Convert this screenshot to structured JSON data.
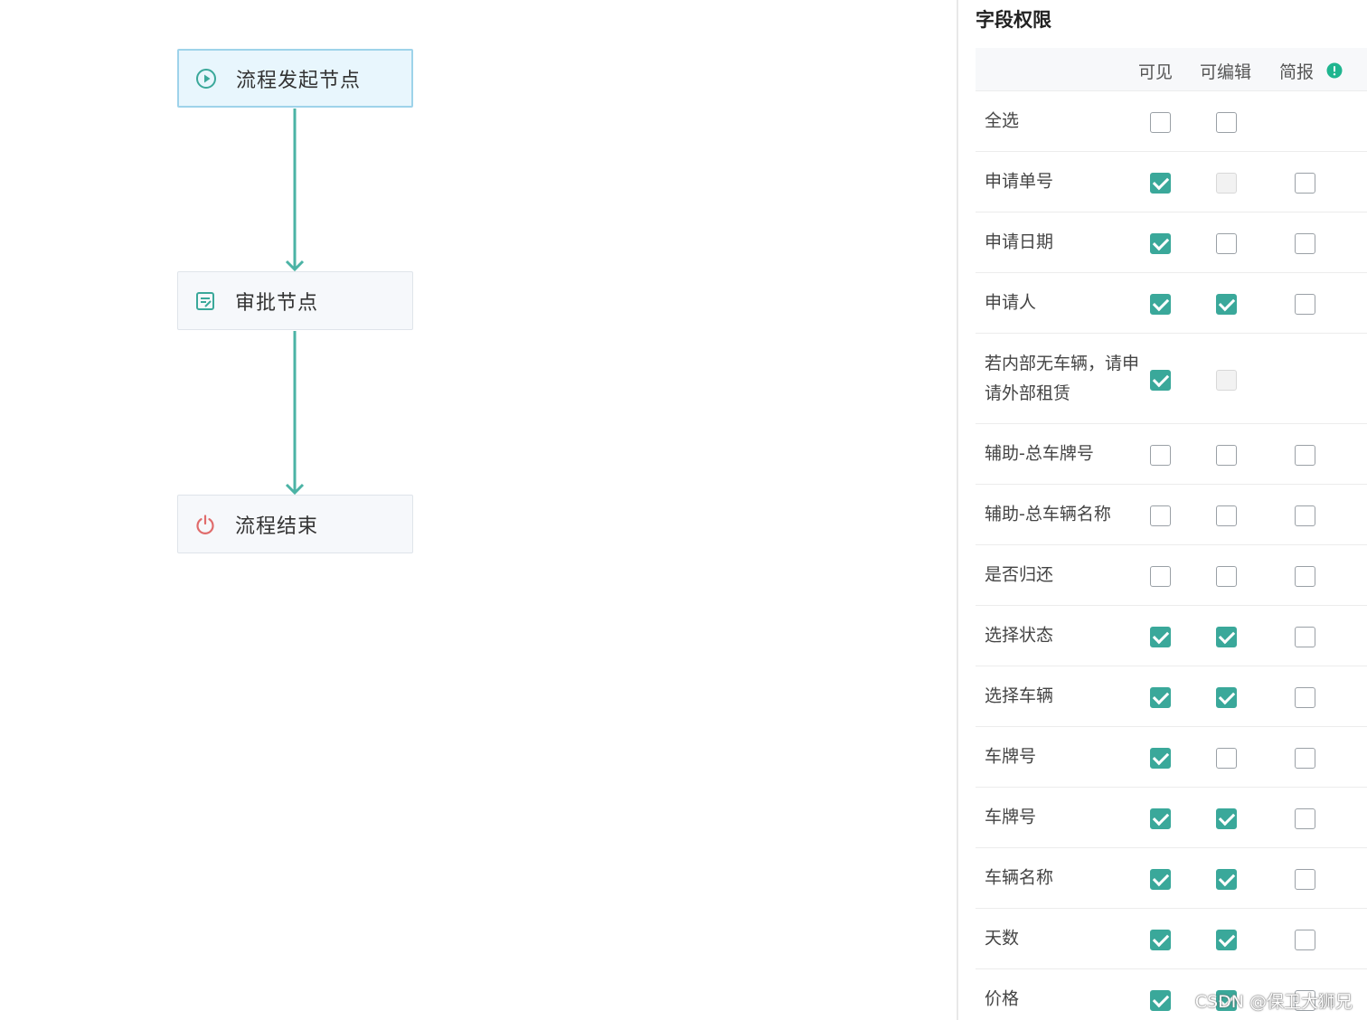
{
  "flow": {
    "nodes": [
      {
        "label": "流程发起节点",
        "icon": "play-circle-icon"
      },
      {
        "label": "审批节点",
        "icon": "approval-form-icon"
      },
      {
        "label": "流程结束",
        "icon": "power-icon"
      }
    ]
  },
  "panel": {
    "title": "字段权限",
    "headers": {
      "visible": "可见",
      "editable": "可编辑",
      "brief": "简报"
    },
    "rows": [
      {
        "name": "全选",
        "visible": "unchecked",
        "editable": "unchecked",
        "brief": "none"
      },
      {
        "name": "申请单号",
        "visible": "checked",
        "editable": "disabled",
        "brief": "unchecked"
      },
      {
        "name": "申请日期",
        "visible": "checked",
        "editable": "unchecked",
        "brief": "unchecked"
      },
      {
        "name": "申请人",
        "visible": "checked",
        "editable": "checked",
        "brief": "unchecked"
      },
      {
        "name": "若内部无车辆，请申请外部租赁",
        "visible": "checked",
        "editable": "disabled",
        "brief": "none"
      },
      {
        "name": "辅助-总车牌号",
        "visible": "unchecked",
        "editable": "unchecked",
        "brief": "unchecked"
      },
      {
        "name": "辅助-总车辆名称",
        "visible": "unchecked",
        "editable": "unchecked",
        "brief": "unchecked"
      },
      {
        "name": "是否归还",
        "visible": "unchecked",
        "editable": "unchecked",
        "brief": "unchecked"
      },
      {
        "name": "选择状态",
        "visible": "checked",
        "editable": "checked",
        "brief": "unchecked"
      },
      {
        "name": "选择车辆",
        "visible": "checked",
        "editable": "checked",
        "brief": "unchecked"
      },
      {
        "name": "车牌号",
        "visible": "checked",
        "editable": "unchecked",
        "brief": "unchecked"
      },
      {
        "name": "车牌号",
        "visible": "checked",
        "editable": "checked",
        "brief": "unchecked"
      },
      {
        "name": "车辆名称",
        "visible": "checked",
        "editable": "checked",
        "brief": "unchecked"
      },
      {
        "name": "天数",
        "visible": "checked",
        "editable": "checked",
        "brief": "unchecked"
      },
      {
        "name": "价格",
        "visible": "checked",
        "editable": "checked",
        "brief": "unchecked"
      }
    ]
  },
  "watermark": "CSDN @保卫大狮兄",
  "colors": {
    "accent": "#3aa89a",
    "start_node_bg": "#e8f6fd",
    "start_node_border": "#9ed3ea",
    "end_icon": "#e06b6b"
  }
}
